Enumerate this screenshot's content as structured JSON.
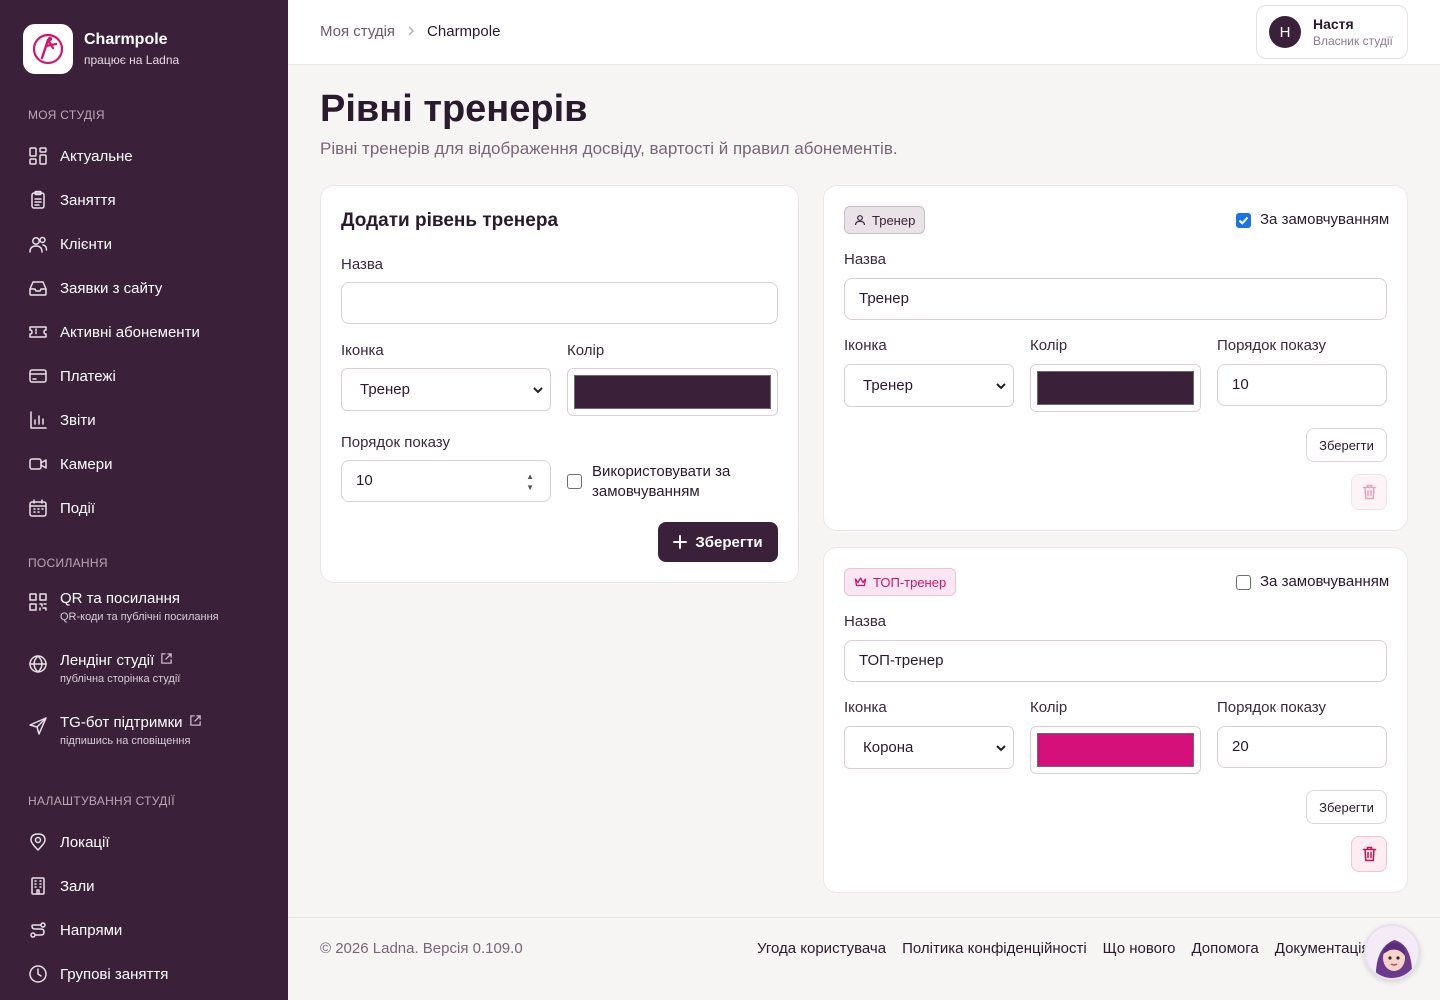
{
  "brand": {
    "name": "Charmpole",
    "subtitle": "працює на Ladna"
  },
  "sidebar": {
    "section_studio": "Моя студія",
    "studio_items": [
      {
        "label": "Актуальне",
        "icon": "dashboard-icon"
      },
      {
        "label": "Заняття",
        "icon": "clipboard-icon"
      },
      {
        "label": "Клієнти",
        "icon": "users-icon"
      },
      {
        "label": "Заявки з сайту",
        "icon": "inbox-icon"
      },
      {
        "label": "Активні абонементи",
        "icon": "ticket-icon"
      },
      {
        "label": "Платежі",
        "icon": "credit-card-icon"
      },
      {
        "label": "Звіти",
        "icon": "bar-chart-icon"
      },
      {
        "label": "Камери",
        "icon": "video-icon"
      },
      {
        "label": "Події",
        "icon": "calendar-icon"
      }
    ],
    "section_links": "Посилання",
    "link_items": [
      {
        "label": "QR та посилання",
        "sub": "QR-коди та публічні посилання",
        "icon": "qr-icon"
      },
      {
        "label": "Лендінг студії",
        "sub": "публічна сторінка студії",
        "icon": "globe-icon"
      },
      {
        "label": "TG-бот підтримки",
        "sub": "підпишись на сповіщення",
        "icon": "send-icon"
      }
    ],
    "section_settings": "Налаштування студії",
    "settings_items": [
      {
        "label": "Локації",
        "icon": "map-pin-icon"
      },
      {
        "label": "Зали",
        "icon": "building-icon"
      },
      {
        "label": "Напрями",
        "icon": "route-icon"
      },
      {
        "label": "Групові заняття",
        "icon": "clock-icon"
      }
    ]
  },
  "header": {
    "breadcrumb_root": "Моя студія",
    "breadcrumb_current": "Charmpole",
    "user_initial": "Н",
    "user_name": "Настя",
    "user_role": "Власник студії"
  },
  "page": {
    "title": "Рівні тренерів",
    "subtitle": "Рівні тренерів для відображення досвіду, вартості й правил абонементів."
  },
  "add_form": {
    "title": "Додати рівень тренера",
    "name_label": "Назва",
    "name_value": "",
    "icon_label": "Іконка",
    "icon_value": "Тренер",
    "color_label": "Колір",
    "color_value": "#3a2139",
    "order_label": "Порядок показу",
    "order_value": "10",
    "default_label": "Використовувати за замовчуванням",
    "default_checked": false,
    "save_label": "Зберегти"
  },
  "levels": [
    {
      "badge": "Тренер",
      "badge_icon": "user-icon",
      "badge_bg": "#e9e3e8",
      "badge_color": "#3a2139",
      "default_label": "За замовчуванням",
      "default_checked": true,
      "name_label": "Назва",
      "name_value": "Тренер",
      "icon_label": "Іконка",
      "icon_value": "Тренер",
      "color_label": "Колір",
      "color_value": "#3a2139",
      "order_label": "Порядок показу",
      "order_value": "10",
      "save_label": "Зберегти",
      "delete_enabled": false
    },
    {
      "badge": "ТОП-тренер",
      "badge_icon": "crown-icon",
      "badge_bg": "#fbe6f1",
      "badge_color": "#d4146f",
      "default_label": "За замовчуванням",
      "default_checked": false,
      "name_label": "Назва",
      "name_value": "ТОП-тренер",
      "icon_label": "Іконка",
      "icon_value": "Корона",
      "color_label": "Колір",
      "color_value": "#d6107a",
      "order_label": "Порядок показу",
      "order_value": "20",
      "save_label": "Зберегти",
      "delete_enabled": true
    }
  ],
  "footer": {
    "copyright": "© 2026 Ladna. Версія 0.109.0",
    "links": [
      "Угода користувача",
      "Політика конфіденційності",
      "Що нового",
      "Допомога",
      "Документація"
    ]
  },
  "colors": {
    "sidebar": "#3a2139",
    "accent": "#d4146f",
    "background": "#f7f5f4"
  }
}
